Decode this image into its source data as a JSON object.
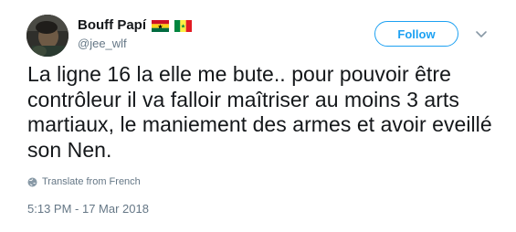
{
  "author": {
    "display_name": "Bouff Papí",
    "handle": "@jee_wlf",
    "flags": [
      "ghana-flag-icon",
      "senegal-flag-icon"
    ]
  },
  "actions": {
    "follow_label": "Follow",
    "more_icon": "chevron-down-icon"
  },
  "tweet": {
    "text": "La ligne 16 la elle me bute.. pour pouvoir être contrôleur il va falloir maîtriser au moins 3 arts martiaux, le maniement des armes et avoir eveillé son Nen.",
    "translate_label": "Translate from French",
    "timestamp": "5:13 PM - 17 Mar 2018"
  },
  "colors": {
    "accent": "#1da1f2",
    "text_primary": "#14171a",
    "text_secondary": "#657786",
    "ghana_red": "#ce1126",
    "ghana_gold": "#fcd116",
    "ghana_green": "#006b3f",
    "senegal_green": "#00853f",
    "senegal_yellow": "#fdef42",
    "senegal_red": "#e31b23"
  }
}
